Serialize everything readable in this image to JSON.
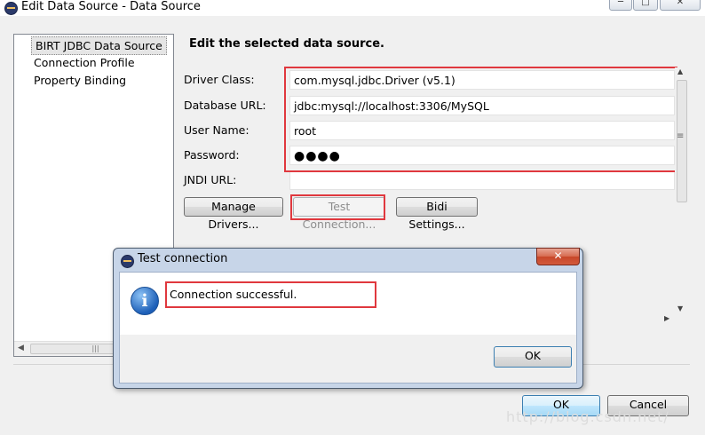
{
  "window": {
    "title": "Edit Data Source - Data Source"
  },
  "tree": {
    "items": [
      {
        "label": "BIRT JDBC Data Source"
      },
      {
        "label": "Connection Profile"
      },
      {
        "label": "Property Binding"
      }
    ]
  },
  "form": {
    "section_title": "Edit the selected data source.",
    "driver_class_label": "Driver Class:",
    "driver_class_value": "com.mysql.jdbc.Driver (v5.1)",
    "database_url_label": "Database URL:",
    "database_url_value": "jdbc:mysql://localhost:3306/MySQL",
    "user_name_label": "User Name:",
    "user_name_value": "root",
    "password_label": "Password:",
    "password_value": "●●●●",
    "jndi_url_label": "JNDI URL:",
    "jndi_url_value": "",
    "manage_drivers_label": "Manage Drivers...",
    "test_connection_label": "Test Connection...",
    "bidi_settings_label": "Bidi Settings..."
  },
  "footer": {
    "ok_label": "OK",
    "cancel_label": "Cancel"
  },
  "watermark": "http://blog.csdn.net/",
  "dialog": {
    "title": "Test connection",
    "close_glyph": "✕",
    "message": "Connection successful.",
    "ok_label": "OK",
    "info_glyph": "i"
  },
  "colors": {
    "highlight": "#e0383e",
    "dialog_frame": "#c7d5e8"
  }
}
